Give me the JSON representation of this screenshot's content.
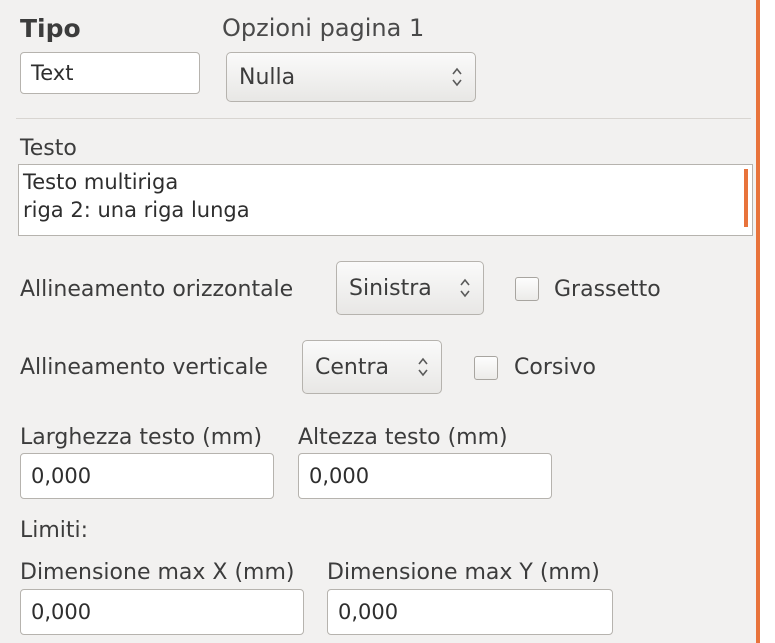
{
  "header": {
    "tipo_label": "Tipo",
    "tipo_value": "Text",
    "options_label": "Opzioni pagina 1",
    "options_value": "Nulla"
  },
  "text_section": {
    "label": "Testo",
    "lines": [
      "Testo multiriga",
      "riga 2: una riga lunga"
    ]
  },
  "h_align": {
    "label": "Allineamento orizzontale",
    "value": "Sinistra",
    "checkbox_label": "Grassetto",
    "checked": false
  },
  "v_align": {
    "label": "Allineamento verticale",
    "value": "Centra",
    "checkbox_label": "Corsivo",
    "checked": false
  },
  "text_size": {
    "width_label": "Larghezza testo (mm)",
    "width_value": "0,000",
    "height_label": "Altezza testo (mm)",
    "height_value": "0,000"
  },
  "limits": {
    "label": "Limiti:",
    "max_x_label": "Dimensione max X (mm)",
    "max_x_value": "0,000",
    "max_y_label": "Dimensione max Y (mm)",
    "max_y_value": "0,000"
  },
  "colors": {
    "accent": "#e8733b",
    "background": "#f2f1f0"
  },
  "icons": [
    "spin-updown-icon",
    "checkbox-icon"
  ]
}
